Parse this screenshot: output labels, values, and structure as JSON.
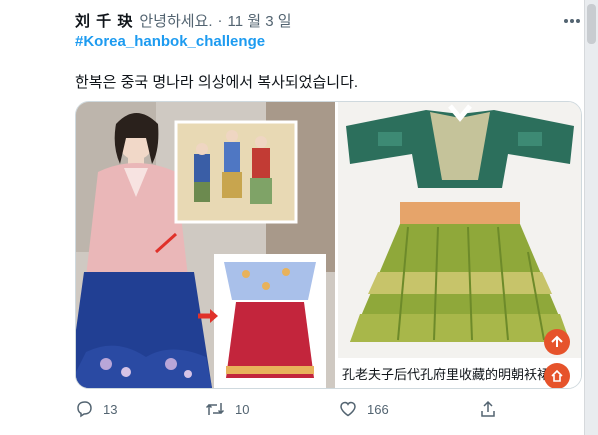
{
  "tweet": {
    "author_name": "刘 千 玦",
    "author_handle": "안녕하세요.",
    "separator": "·",
    "date": "11 월 3 일",
    "hashtag": "#Korea_hanbok_challenge",
    "text": "한복은 중국 명나라 의상에서 복사되었습니다."
  },
  "media": {
    "caption": "孔老夫子后代孔府里收藏的明朝袄裙"
  },
  "actions": {
    "reply_count": "13",
    "retweet_count": "10",
    "like_count": "166"
  },
  "icons": {
    "more": "more-icon",
    "reply": "reply-icon",
    "retweet": "retweet-icon",
    "like": "heart-icon",
    "share": "share-icon",
    "up": "arrow-up-icon",
    "home": "home-icon"
  },
  "colors": {
    "accent": "#1d9bf0",
    "fab": "#e6532b",
    "muted": "#536471"
  }
}
